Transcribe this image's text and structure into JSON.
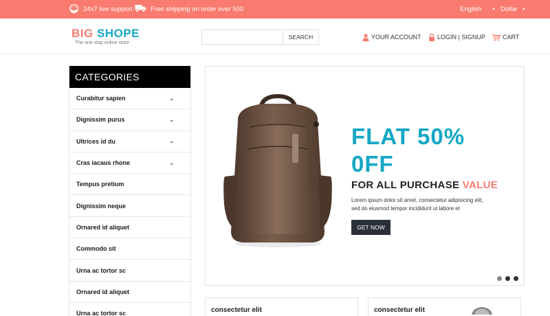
{
  "topbar": {
    "support_text": "24x7 live support",
    "shipping_text": "Free shipping on order over 500",
    "language": "English",
    "currency": "Dollar",
    "bg_color": "#f97b6f"
  },
  "header": {
    "logo_big": "BIG",
    "logo_shope": "SHOPE",
    "tagline": "The one stop online store",
    "search_placeholder": "",
    "search_button": "SEARCH",
    "account_label": "YOUR ACCOUNT",
    "login_label": "LOGIN | SIGNUP",
    "cart_label": "CART"
  },
  "categories": {
    "title": "CATEGORIES",
    "items": [
      {
        "label": "Curabitur sapien",
        "expandable": true
      },
      {
        "label": "Dignissim purus",
        "expandable": true
      },
      {
        "label": "Ultrices id du",
        "expandable": true
      },
      {
        "label": "Cras iacaus rhone",
        "expandable": true
      },
      {
        "label": "Tempus pretium",
        "expandable": false
      },
      {
        "label": "Dignissim neque",
        "expandable": false
      },
      {
        "label": "Ornared id aliquet",
        "expandable": false
      },
      {
        "label": "Commodo sit",
        "expandable": false
      },
      {
        "label": "Urna ac tortor sc",
        "expandable": false
      },
      {
        "label": "Ornared id aliquet",
        "expandable": false
      },
      {
        "label": "Urna ac tortor sc",
        "expandable": false
      }
    ]
  },
  "banner": {
    "headline_line1": "FLAT 50%",
    "headline_line2": "0FF",
    "subhead_main": "FOR ALL PURCHASE",
    "subhead_accent": "VALUE",
    "body_line1": "Lorem ipsum dolor sit amet, consectetur adipisicing elit,",
    "body_line2": "sed do eiusmod tempor incididunt ut labore et",
    "cta": "GET NOW",
    "slides_total": 3,
    "active_slide": 2,
    "accent_color": "#14a7c5"
  },
  "products": [
    {
      "title": "consectetur elit"
    },
    {
      "title": "consectetur elit"
    }
  ]
}
